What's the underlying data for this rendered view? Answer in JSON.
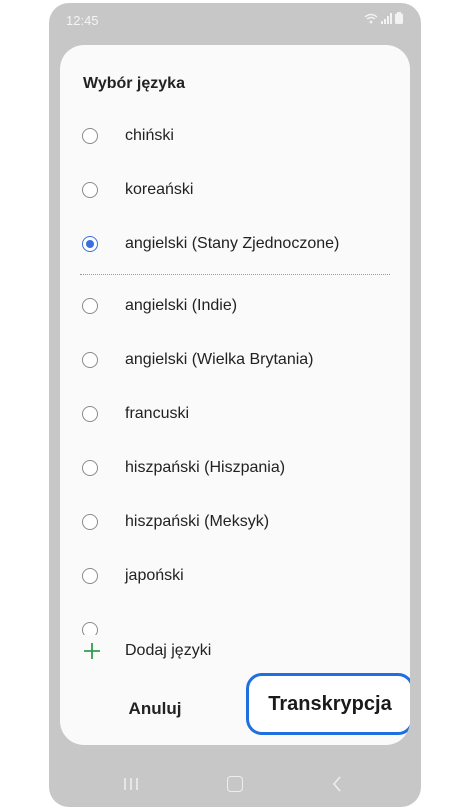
{
  "status_bar": {
    "time": "12:45"
  },
  "dialog": {
    "title": "Wybór języka",
    "languages": [
      {
        "label": "chiński",
        "selected": false
      },
      {
        "label": "koreański",
        "selected": false
      },
      {
        "label": "angielski (Stany Zjednoczone)",
        "selected": true
      },
      {
        "label": "angielski (Indie)",
        "selected": false
      },
      {
        "label": "angielski (Wielka Brytania)",
        "selected": false
      },
      {
        "label": "francuski",
        "selected": false
      },
      {
        "label": "hiszpański (Hiszpania)",
        "selected": false
      },
      {
        "label": "hiszpański (Meksyk)",
        "selected": false
      },
      {
        "label": "japoński",
        "selected": false
      }
    ],
    "add_languages_label": "Dodaj języki",
    "cancel_label": "Anuluj",
    "transcribe_label": "Transkrypcja"
  },
  "colors": {
    "accent": "#3b6fe0",
    "highlight_border": "#1f6fe0",
    "add_icon": "#2e9e4f"
  },
  "icons": [
    "wifi-icon",
    "signal-icon",
    "battery-icon",
    "radio-icon",
    "plus-icon",
    "recent-apps-icon",
    "home-icon",
    "back-icon"
  ]
}
